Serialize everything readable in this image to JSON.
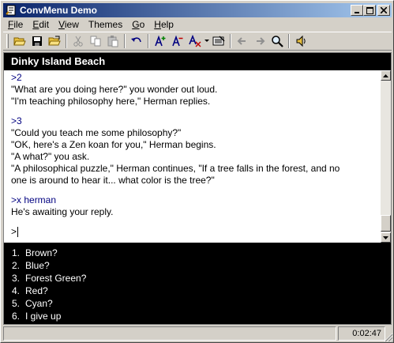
{
  "window": {
    "title": "ConvMenu Demo",
    "controls": {
      "minimize": "_",
      "maximize": "□",
      "close": "×"
    }
  },
  "menu": [
    {
      "label_u": "F",
      "label_rest": "ile"
    },
    {
      "label_u": "E",
      "label_rest": "dit"
    },
    {
      "label_u": "V",
      "label_rest": "iew"
    },
    {
      "label_u": "",
      "label_rest": "Themes"
    },
    {
      "label_u": "G",
      "label_rest": "o"
    },
    {
      "label_u": "H",
      "label_rest": "elp"
    }
  ],
  "toolbar": {
    "icons": [
      "open-folder-icon",
      "save-icon",
      "open-file-icon",
      "cut-icon",
      "copy-icon",
      "paste-icon",
      "undo-icon",
      "font-increase-icon",
      "font-decrease-icon",
      "font-style-icon",
      "dropdown-arrow-icon",
      "preferences-icon",
      "back-arrow-icon",
      "forward-arrow-icon",
      "search-icon",
      "sound-icon"
    ]
  },
  "location": "Dinky Island Beach",
  "transcript": {
    "block1": {
      "cmd": ">2",
      "lines": [
        "\"What are you doing here?\" you wonder out loud.",
        "\"I'm teaching philosophy here,\" Herman replies."
      ]
    },
    "block2": {
      "cmd": ">3",
      "lines": [
        "\"Could you teach me some philosophy?\"",
        "\"OK, here's a Zen koan for you,\" Herman begins.",
        "\"A what?\" you ask."
      ],
      "long_line_1": "\"A philosophical puzzle,\" Herman continues, \"If a tree falls in the forest, and no",
      "long_line_2": "one is around to hear it... what color is the tree?\""
    },
    "block3": {
      "cmd": ">x herman",
      "lines": [
        "He's awaiting your reply."
      ]
    },
    "prompt": ">"
  },
  "options": [
    {
      "num": "1.",
      "text": "Brown?"
    },
    {
      "num": "2.",
      "text": "Blue?"
    },
    {
      "num": "3.",
      "text": "Forest Green?"
    },
    {
      "num": "4.",
      "text": "Red?"
    },
    {
      "num": "5.",
      "text": "Cyan?"
    },
    {
      "num": "6.",
      "text": "I give up"
    }
  ],
  "status": {
    "message": "",
    "timer": "0:02:47"
  }
}
